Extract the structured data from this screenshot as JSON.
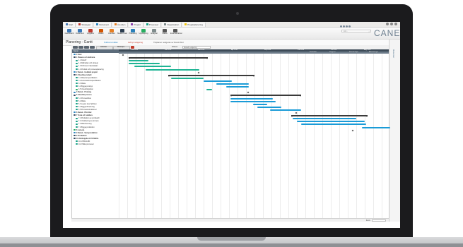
{
  "browser": {
    "tabs": [
      {
        "label": "Start",
        "color": "#4a7bb5"
      },
      {
        "label": "Strategier",
        "color": "#c0392b"
      },
      {
        "label": "Dokument",
        "color": "#2e86c1"
      },
      {
        "label": "Ärenden",
        "color": "#e67e22"
      },
      {
        "label": "Projekt",
        "color": "#8e44ad"
      },
      {
        "label": "Processer",
        "color": "#16a085"
      },
      {
        "label": "Organisation",
        "color": "#7f8c8d"
      },
      {
        "label": "Projektplanering",
        "color": "#f1c40f"
      }
    ]
  },
  "toolbar": {
    "items": [
      {
        "label": "Dashboard",
        "color": "#3a78b8"
      },
      {
        "label": "Dokument",
        "color": "#3a78b8"
      },
      {
        "label": "Uppgifter",
        "color": "#c0392b"
      },
      {
        "label": "Risker",
        "color": "#d35400"
      },
      {
        "label": "Ärenden",
        "color": "#e67e22"
      },
      {
        "label": "Medlemmar",
        "color": "#2c3e50"
      },
      {
        "label": "Planering",
        "color": "#2980b9"
      },
      {
        "label": "Uppföljning",
        "color": "#27ae60"
      },
      {
        "label": "Analyser",
        "color": "#7f8c8d"
      },
      {
        "label": "Status",
        "color": "#555555"
      },
      {
        "label": "Externa länkar",
        "color": "#555555"
      }
    ],
    "search_placeholder": "sök...",
    "logo": "CANEA"
  },
  "page": {
    "title": "Planering - Gantt",
    "links": [
      "Publicera källan",
      "Avbryt redigering",
      "Tidplanen redigeras av David Wert"
    ]
  },
  "ribbon": {
    "select_label": "Filtrera",
    "select_value": "Aktuell redigering",
    "buttons": [
      "Aktivitet",
      "Milstolpe"
    ]
  },
  "side_tab": {
    "label": "Resurser"
  },
  "tasks": [
    {
      "label": "0 Start",
      "icon": "#2e86c1"
    },
    {
      "label": "1 Planera och definiera",
      "icon": "#34495e"
    },
    {
      "label": "1.1 Kickoff",
      "icon": "#16a085"
    },
    {
      "label": "1.2 Affärsplan och strategi",
      "icon": "#16a085"
    },
    {
      "label": "1.3 Förbered materialplan",
      "icon": "#16a085"
    },
    {
      "label": "1.4 Produkt och processplanering",
      "icon": "#16a085"
    },
    {
      "label": "2 Beslut - Godkänt projekt",
      "icon": "#2e86c1"
    },
    {
      "label": "3 Utveckla produkt",
      "icon": "#34495e"
    },
    {
      "label": "3.1 Material specifikation",
      "icon": "#16a085"
    },
    {
      "label": "3.2 Konstruktionsspecifikation",
      "icon": "#16a085"
    },
    {
      "label": "3.3 Mätta",
      "icon": "#16a085"
    },
    {
      "label": "3.4 Bygga prototyp",
      "icon": "#16a085"
    },
    {
      "label": "3.5 Utvecklingsplan",
      "icon": "#27ae60"
    },
    {
      "label": "4 Beslut - Prototyp",
      "icon": "#2e86c1"
    },
    {
      "label": "5 Utveckla process",
      "icon": "#34495e"
    },
    {
      "label": "5.1 Processflöde",
      "icon": "#16a085"
    },
    {
      "label": "5.2 Mätta",
      "icon": "#16a085"
    },
    {
      "label": "5.3 Layout över fabriken",
      "icon": "#16a085"
    },
    {
      "label": "5.4 Bygga tillverkning",
      "icon": "#16a085"
    },
    {
      "label": "5.5 Processinstruktioner",
      "icon": "#16a085"
    },
    {
      "label": "6 Beslut - Pilot klar",
      "icon": "#2e86c1"
    },
    {
      "label": "7 Testa och validera",
      "icon": "#34495e"
    },
    {
      "label": "7.1 Produktion av provbatch",
      "icon": "#16a085"
    },
    {
      "label": "7.2 Utvärdering av process",
      "icon": "#16a085"
    },
    {
      "label": "7.3 Mätutrustning",
      "icon": "#16a085"
    },
    {
      "label": "7.4 Bygga produktion",
      "icon": "#16a085"
    },
    {
      "label": "8 Lansera",
      "icon": "#27ae60"
    },
    {
      "label": "9 Beslut - Serieproduktion",
      "icon": "#2e86c1"
    },
    {
      "label": "9 Produktion",
      "icon": "#34495e"
    },
    {
      "label": "10 Återkoppla och förbättra",
      "icon": "#34495e"
    },
    {
      "label": "10.1 PDCA-RD",
      "icon": "#16a085"
    },
    {
      "label": "10.2 Mäta processer",
      "icon": "#16a085"
    }
  ],
  "gantt": {
    "months": [
      "Jan 2018",
      "Feb 2018",
      "Mar 2018",
      "Apr 2018",
      "Maj 2018",
      "Jun 2018",
      "Jul 2018",
      "Aug 2018"
    ],
    "header_right": [
      "Kostnader",
      "Progress",
      "Kritiska linjen",
      "Aktivitetsvyer"
    ]
  },
  "statusbar": {
    "label": "Zoom"
  }
}
